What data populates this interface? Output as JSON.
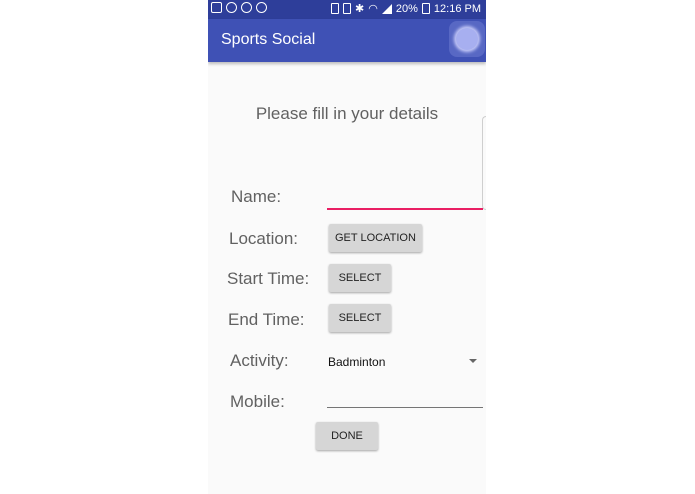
{
  "status_bar": {
    "battery": "20%",
    "time": "12:16 PM"
  },
  "app_bar": {
    "title": "Sports Social"
  },
  "form": {
    "heading": "Please fill in your details",
    "name_label": "Name:",
    "name_value": "",
    "location_label": "Location:",
    "location_button": "GET LOCATION",
    "start_label": "Start Time:",
    "start_button": "SELECT",
    "end_label": "End Time:",
    "end_button": "SELECT",
    "activity_label": "Activity:",
    "activity_value": "Badminton",
    "mobile_label": "Mobile:",
    "mobile_value": "",
    "done_button": "DONE"
  },
  "colors": {
    "app_bar": "#3f51b5",
    "status_bar": "#2e3e9a",
    "focused_underline": "#e91e63"
  }
}
